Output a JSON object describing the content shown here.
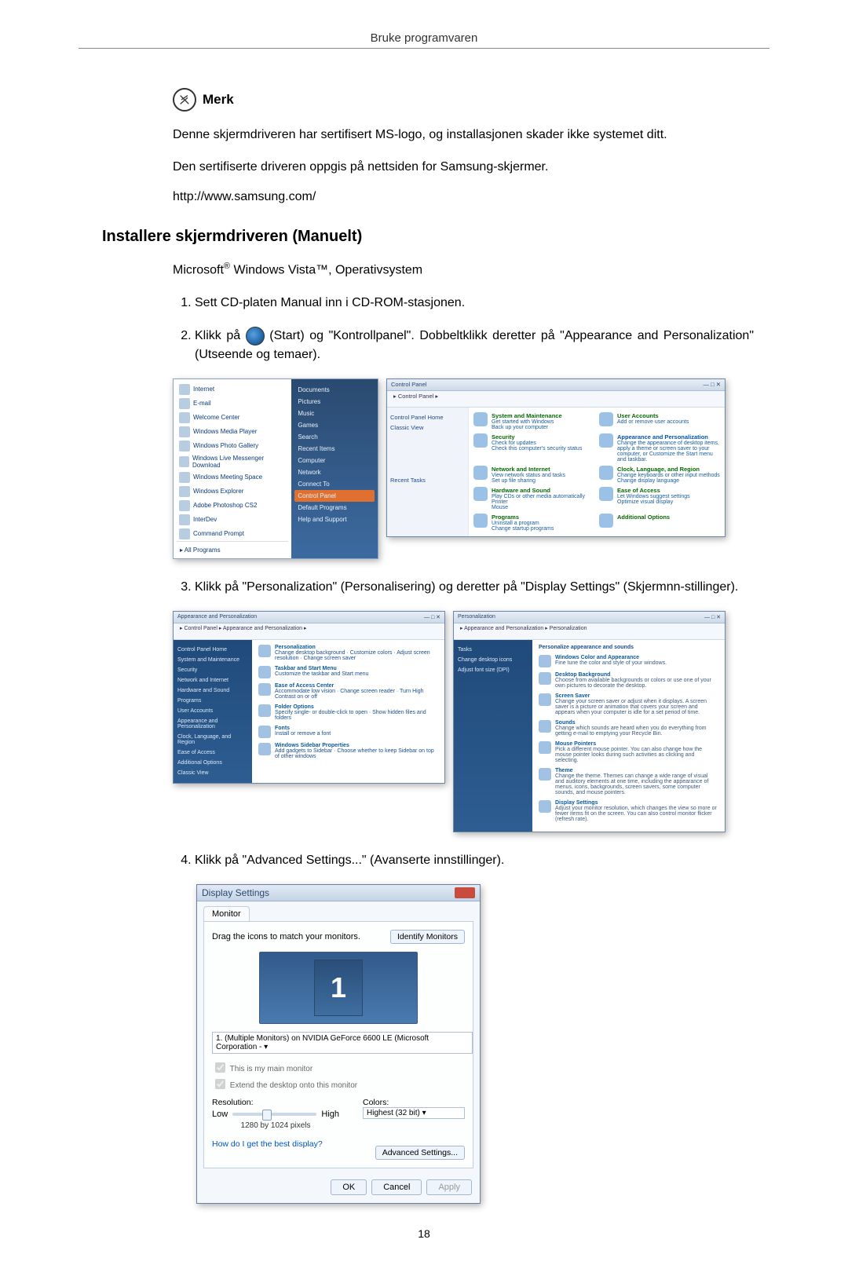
{
  "header": "Bruke programvaren",
  "merk_label": "Merk",
  "para1": "Denne skjermdriveren har sertifisert MS-logo, og installasjonen skader ikke systemet ditt.",
  "para2": "Den sertifiserte driveren oppgis på nettsiden for Samsung-skjermer.",
  "url": "http://www.samsung.com/",
  "h2": "Installere skjermdriveren (Manuelt)",
  "ms_line_before": "Microsoft",
  "ms_line_after": " Windows Vista™, Operativsystem",
  "steps": {
    "s1": "Sett CD-platen Manual inn i CD-ROM-stasjonen.",
    "s2a": "Klikk på ",
    "s2b": "(Start) og \"Kontrollpanel\". Dobbeltklikk deretter på \"Appearance and Personalization\" (Utseende og temaer).",
    "s3": "Klikk på \"Personalization\" (Personalisering) og deretter på \"Display Settings\" (Skjermnn-stillinger).",
    "s4": "Klikk på \"Advanced Settings...\" (Avanserte innstillinger)."
  },
  "start_menu": {
    "left": [
      "Internet",
      "E-mail",
      "Welcome Center",
      "Windows Media Player",
      "Windows Photo Gallery",
      "Windows Live Messenger Download",
      "Windows Meeting Space",
      "Windows Explorer",
      "Adobe Photoshop CS2",
      "InterDev",
      "Command Prompt"
    ],
    "all": "All Programs",
    "right": [
      "Documents",
      "Pictures",
      "Music",
      "Games",
      "Search",
      "Recent Items",
      "Computer",
      "Network",
      "Connect To",
      "Control Panel",
      "Default Programs",
      "Help and Support"
    ]
  },
  "cpl": {
    "addr": "▸ Control Panel ▸",
    "side": [
      "Control Panel Home",
      "Classic View"
    ],
    "side2": [
      "Recent Tasks"
    ],
    "cats": [
      {
        "head": "System and Maintenance",
        "sub": "Get started with Windows\nBack up your computer"
      },
      {
        "head": "User Accounts",
        "sub": "Add or remove user accounts"
      },
      {
        "head": "Security",
        "sub": "Check for updates\nCheck this computer's security status"
      },
      {
        "head": "Appearance and Personalization",
        "sub": "Change the appearance of desktop items, apply a theme or screen saver to your computer, or Customize the Start menu and taskbar.",
        "hl": true
      },
      {
        "head": "Network and Internet",
        "sub": "View network status and tasks\nSet up file sharing"
      },
      {
        "head": "Clock, Language, and Region",
        "sub": "Change keyboards or other input methods\nChange display language"
      },
      {
        "head": "Hardware and Sound",
        "sub": "Play CDs or other media automatically\nPrinter\nMouse"
      },
      {
        "head": "Ease of Access",
        "sub": "Let Windows suggest settings\nOptimize visual display"
      },
      {
        "head": "Programs",
        "sub": "Uninstall a program\nChange startup programs"
      },
      {
        "head": "Additional Options",
        "sub": ""
      }
    ]
  },
  "pers1": {
    "addr": "▸ Control Panel ▸ Appearance and Personalization ▸",
    "side": [
      "Control Panel Home",
      "System and Maintenance",
      "Security",
      "Network and Internet",
      "Hardware and Sound",
      "Programs",
      "User Accounts",
      "Appearance and Personalization",
      "Clock, Language, and Region",
      "Ease of Access",
      "Additional Options",
      "Classic View"
    ],
    "items": [
      {
        "t": "Personalization",
        "s": "Change desktop background · Customize colors · Adjust screen resolution · Change screen saver"
      },
      {
        "t": "Taskbar and Start Menu",
        "s": "Customize the taskbar and Start menu"
      },
      {
        "t": "Ease of Access Center",
        "s": "Accommodate low vision · Change screen reader · Turn High Contrast on or off"
      },
      {
        "t": "Folder Options",
        "s": "Specify single- or double-click to open · Show hidden files and folders"
      },
      {
        "t": "Fonts",
        "s": "Install or remove a font"
      },
      {
        "t": "Windows Sidebar Properties",
        "s": "Add gadgets to Sidebar · Choose whether to keep Sidebar on top of other windows"
      }
    ]
  },
  "pers2": {
    "addr": "▸ Appearance and Personalization ▸ Personalization",
    "tasks": [
      "Tasks",
      "Change desktop icons",
      "Adjust font size (DPI)"
    ],
    "heading": "Personalize appearance and sounds",
    "items": [
      {
        "t": "Windows Color and Appearance",
        "s": "Fine tune the color and style of your windows."
      },
      {
        "t": "Desktop Background",
        "s": "Choose from available backgrounds or colors or use one of your own pictures to decorate the desktop."
      },
      {
        "t": "Screen Saver",
        "s": "Change your screen saver or adjust when it displays. A screen saver is a picture or animation that covers your screen and appears when your computer is idle for a set period of time."
      },
      {
        "t": "Sounds",
        "s": "Change which sounds are heard when you do everything from getting e-mail to emptying your Recycle Bin."
      },
      {
        "t": "Mouse Pointers",
        "s": "Pick a different mouse pointer. You can also change how the mouse pointer looks during such activities as clicking and selecting."
      },
      {
        "t": "Theme",
        "s": "Change the theme. Themes can change a wide range of visual and auditory elements at one time, including the appearance of menus, icons, backgrounds, screen savers, some computer sounds, and mouse pointers."
      },
      {
        "t": "Display Settings",
        "s": "Adjust your monitor resolution, which changes the view so more or fewer items fit on the screen. You can also control monitor flicker (refresh rate)."
      }
    ]
  },
  "disp": {
    "title": "Display Settings",
    "tab": "Monitor",
    "drag": "Drag the icons to match your monitors.",
    "identify": "Identify Monitors",
    "combo": "1. (Multiple Monitors) on NVIDIA GeForce 6600 LE (Microsoft Corporation - ▾",
    "chk1": "This is my main monitor",
    "chk2": "Extend the desktop onto this monitor",
    "res_label": "Resolution:",
    "low": "Low",
    "high": "High",
    "res_val": "1280 by 1024 pixels",
    "col_label": "Colors:",
    "col_val": "Highest (32 bit)",
    "link": "How do I get the best display?",
    "adv": "Advanced Settings...",
    "ok": "OK",
    "cancel": "Cancel",
    "apply": "Apply",
    "mon": "1"
  },
  "page_number": "18"
}
